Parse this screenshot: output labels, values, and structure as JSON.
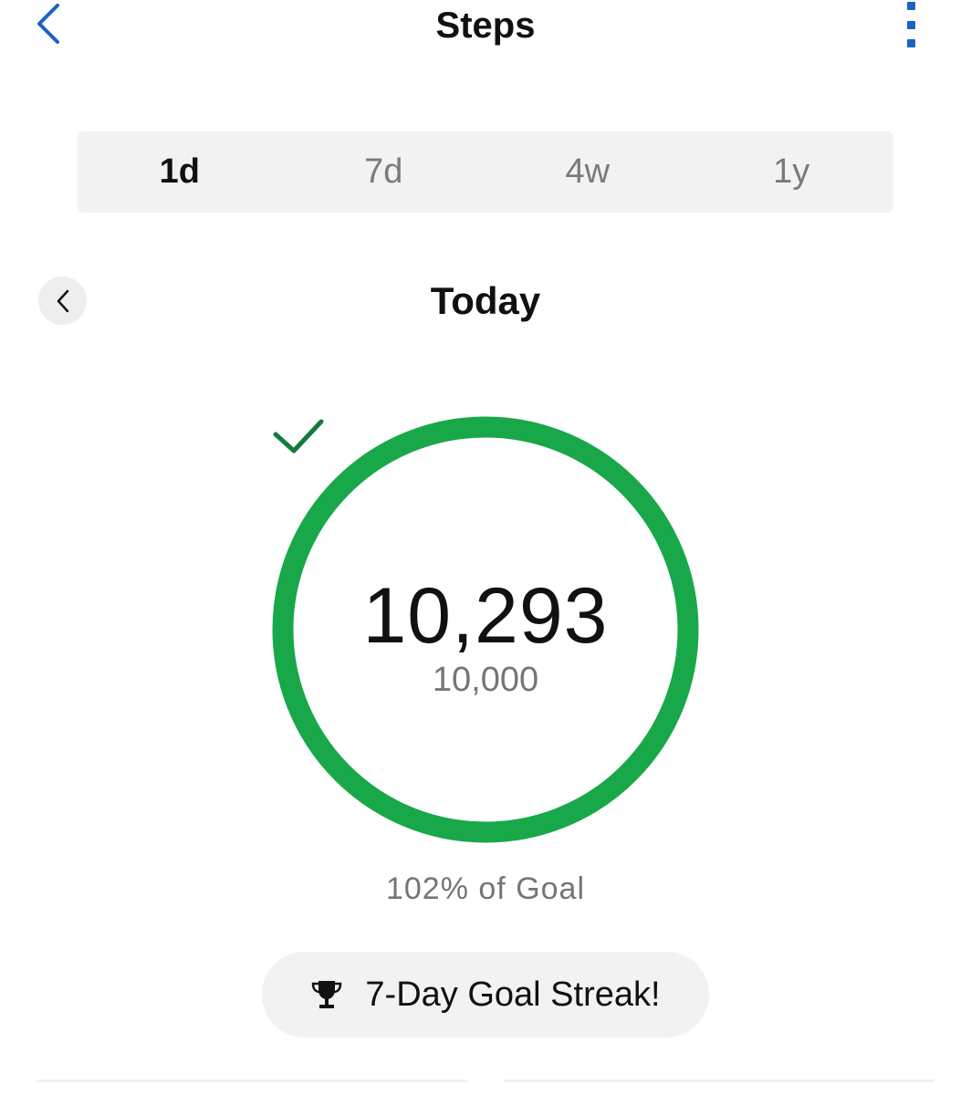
{
  "header": {
    "title": "Steps",
    "back_icon": "chevron-left-icon",
    "more_icon": "more-vertical-icon"
  },
  "range_tabs": [
    {
      "label": "1d",
      "selected": true
    },
    {
      "label": "7d",
      "selected": false
    },
    {
      "label": "4w",
      "selected": false
    },
    {
      "label": "1y",
      "selected": false
    }
  ],
  "date_nav": {
    "label": "Today",
    "prev_icon": "chevron-left-icon"
  },
  "progress": {
    "steps": "10,293",
    "goal": "10,000",
    "percent_label": "102% of Goal",
    "fraction": 1.02,
    "goal_met_icon": "checkmark-icon"
  },
  "streak": {
    "icon": "trophy-icon",
    "label": "7-Day Goal Streak!"
  },
  "colors": {
    "accent": "#1a62c4",
    "ring": "#18a84a",
    "check": "#137a3c",
    "text": "#111111",
    "muted": "#757575"
  }
}
